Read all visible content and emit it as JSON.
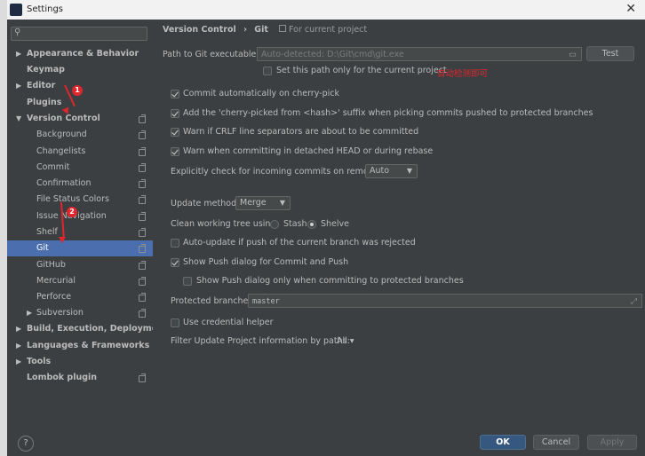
{
  "window": {
    "title": "Settings",
    "close_glyph": "✕"
  },
  "colors": {
    "accent": "#4b6eaf",
    "annotation": "#e0262d",
    "background": "#3c3f41"
  },
  "search": {
    "placeholder": "",
    "icon": "search-icon"
  },
  "sidebar": {
    "items": [
      {
        "label": "Appearance & Behavior",
        "arrow": "▶"
      },
      {
        "label": "Keymap",
        "arrow": ""
      },
      {
        "label": "Editor",
        "arrow": "▶"
      },
      {
        "label": "Plugins",
        "arrow": ""
      },
      {
        "label": "Version Control",
        "arrow": "▼"
      },
      {
        "label": "Background"
      },
      {
        "label": "Changelists"
      },
      {
        "label": "Commit"
      },
      {
        "label": "Confirmation"
      },
      {
        "label": "File Status Colors"
      },
      {
        "label": "Issue Navigation"
      },
      {
        "label": "Shelf"
      },
      {
        "label": "Git"
      },
      {
        "label": "GitHub"
      },
      {
        "label": "Mercurial"
      },
      {
        "label": "Perforce"
      },
      {
        "label": "Subversion",
        "arrow": "▶"
      },
      {
        "label": "Build, Execution, Deployment",
        "arrow": "▶"
      },
      {
        "label": "Languages & Frameworks",
        "arrow": "▶"
      },
      {
        "label": "Tools",
        "arrow": "▶"
      },
      {
        "label": "Lombok plugin",
        "arrow": ""
      }
    ],
    "selected": "Git"
  },
  "annotations": {
    "badge1": "1",
    "badge2": "2",
    "note": "自动检测即可"
  },
  "main": {
    "breadcrumb_parent": "Version Control",
    "breadcrumb_sep": "›",
    "breadcrumb_current": "Git",
    "scope_label": "For current project",
    "path_label": "Path to Git executable:",
    "path_value": "Auto-detected: D:\\Git\\cmd\\git.exe",
    "test_button": "Test",
    "set_path_only_label": "Set this path only for the current project",
    "options": [
      {
        "label": "Commit automatically on cherry-pick",
        "checked": true
      },
      {
        "label": "Add the 'cherry-picked from <hash>' suffix when picking commits pushed to protected branches",
        "checked": true
      },
      {
        "label": "Warn if CRLF line separators are about to be committed",
        "checked": true
      },
      {
        "label": "Warn when committing in detached HEAD or during rebase",
        "checked": true
      }
    ],
    "incoming_label": "Explicitly check for incoming commits on remotes:",
    "incoming_value": "Auto",
    "update_method_label": "Update method:",
    "update_method_value": "Merge",
    "clean_tree_label": "Clean working tree using:",
    "stash_label": "Stash",
    "shelve_label": "Shelve",
    "auto_update_label": "Auto-update if push of the current branch was rejected",
    "show_push_label": "Show Push dialog for Commit and Push",
    "show_push_protected_label": "Show Push dialog only when committing to protected branches",
    "protected_label": "Protected branches:",
    "protected_value": "master",
    "credential_label": "Use credential helper",
    "filter_label": "Filter Update Project information by paths:",
    "filter_value": "All ▾"
  },
  "footer": {
    "help": "?",
    "ok": "OK",
    "cancel": "Cancel",
    "apply": "Apply"
  }
}
